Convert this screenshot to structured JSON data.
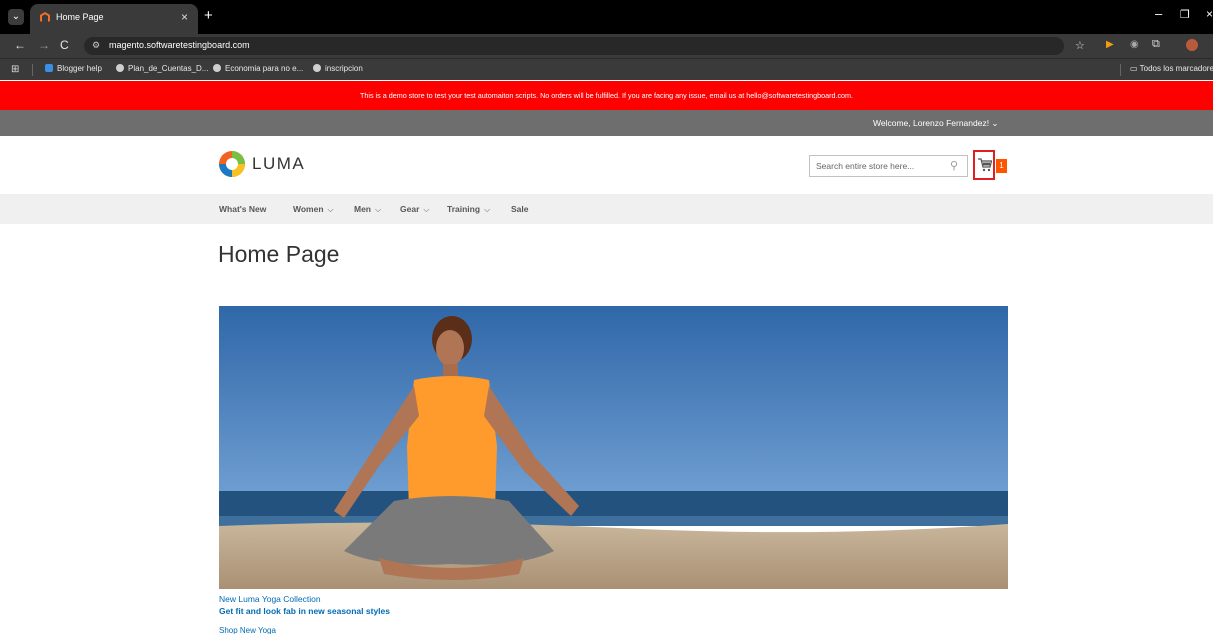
{
  "browser": {
    "tab_title": "Home Page",
    "tab_close": "×",
    "newtab": "+",
    "url": "magento.softwaretestingboard.com",
    "bookmarks": [
      {
        "label": "Blogger help"
      },
      {
        "label": "Plan_de_Cuentas_D..."
      },
      {
        "label": "Economia para no e..."
      },
      {
        "label": "inscripcion"
      }
    ],
    "all_bookmarks": "Todos los marcadores",
    "glyphs": {
      "back": "←",
      "forward": "→",
      "reload": "C",
      "star": "☆",
      "play": "▶",
      "minimize": "–",
      "restore": "❐",
      "close": "×",
      "apps": "⊞",
      "puzzle": "⧉",
      "tab_list": "⌄"
    }
  },
  "store": {
    "demo_notice": "This is a demo store to test your test automaiton scripts. No orders will be fulfilled. If you are facing any issue, email us at hello@softwaretestingboard.com.",
    "welcome": "Welcome, Lorenzo Fernandez! ⌄",
    "logo_text": "LUMA",
    "search_placeholder": "Search entire store here...",
    "search_icon_glyph": "⚲",
    "cart_count": "1",
    "menu": [
      {
        "label": "What's New",
        "chevron": ""
      },
      {
        "label": "Women",
        "chevron": "⌵"
      },
      {
        "label": "Men",
        "chevron": "⌵"
      },
      {
        "label": "Gear",
        "chevron": "⌵"
      },
      {
        "label": "Training",
        "chevron": "⌵"
      },
      {
        "label": "Sale",
        "chevron": ""
      }
    ],
    "page_title": "Home Page",
    "promo": {
      "line1": "New Luma Yoga Collection",
      "line2": "Get fit and look fab in new seasonal styles",
      "line3": "Shop New Yoga"
    },
    "colors": {
      "banner": "#ff0000",
      "accent": "#ff5501",
      "link": "#006bb4"
    }
  }
}
